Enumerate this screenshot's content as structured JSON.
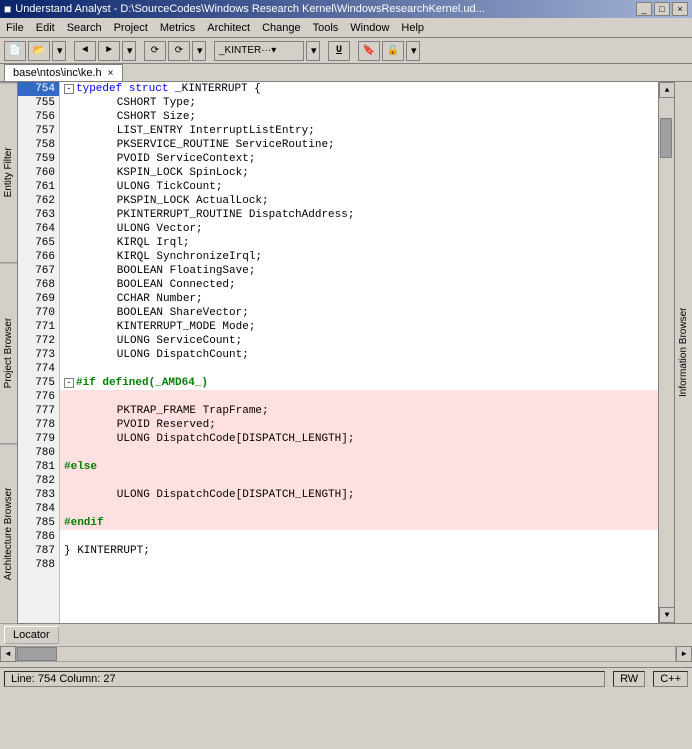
{
  "titlebar": {
    "title": "Understand Analyst - D:\\SourceCodes\\Windows Research Kernel\\WindowsResearchKernel.ud...",
    "icon": "■"
  },
  "menubar": {
    "items": [
      "File",
      "Edit",
      "Search",
      "Project",
      "Metrics",
      "Architect",
      "Change",
      "Tools",
      "Window",
      "Help"
    ]
  },
  "filetab": {
    "label": "base\\ntos\\inc\\ke.h"
  },
  "sidebar_left": {
    "labels": [
      "Entity Filter",
      "Project Browser",
      "Architecture Browser"
    ]
  },
  "sidebar_right": {
    "label": "Information Browser"
  },
  "code": {
    "lines": [
      {
        "num": 754,
        "indent": 0,
        "content": "typedef struct _KINTERRUPT {",
        "type": "typedef",
        "has_collapse": true
      },
      {
        "num": 755,
        "indent": 2,
        "content": "CSHORT Type;",
        "type": "normal"
      },
      {
        "num": 756,
        "indent": 2,
        "content": "CSHORT Size;",
        "type": "normal"
      },
      {
        "num": 757,
        "indent": 2,
        "content": "LIST_ENTRY InterruptListEntry;",
        "type": "normal"
      },
      {
        "num": 758,
        "indent": 2,
        "content": "PKSERVICE_ROUTINE ServiceRoutine;",
        "type": "normal"
      },
      {
        "num": 759,
        "indent": 2,
        "content": "PVOID ServiceContext;",
        "type": "normal"
      },
      {
        "num": 760,
        "indent": 2,
        "content": "KSPIN_LOCK SpinLock;",
        "type": "normal"
      },
      {
        "num": 761,
        "indent": 2,
        "content": "ULONG TickCount;",
        "type": "normal"
      },
      {
        "num": 762,
        "indent": 2,
        "content": "PKSPIN_LOCK ActualLock;",
        "type": "normal"
      },
      {
        "num": 763,
        "indent": 2,
        "content": "PKINTERRUPT_ROUTINE DispatchAddress;",
        "type": "normal"
      },
      {
        "num": 764,
        "indent": 2,
        "content": "ULONG Vector;",
        "type": "normal"
      },
      {
        "num": 765,
        "indent": 2,
        "content": "KIRQL Irql;",
        "type": "normal"
      },
      {
        "num": 766,
        "indent": 2,
        "content": "KIRQL SynchronizeIrql;",
        "type": "normal"
      },
      {
        "num": 767,
        "indent": 2,
        "content": "BOOLEAN FloatingSave;",
        "type": "normal"
      },
      {
        "num": 768,
        "indent": 2,
        "content": "BOOLEAN Connected;",
        "type": "normal"
      },
      {
        "num": 769,
        "indent": 2,
        "content": "CCHAR Number;",
        "type": "normal"
      },
      {
        "num": 770,
        "indent": 2,
        "content": "BOOLEAN ShareVector;",
        "type": "normal"
      },
      {
        "num": 771,
        "indent": 2,
        "content": "KINTERRUPT_MODE Mode;",
        "type": "normal"
      },
      {
        "num": 772,
        "indent": 2,
        "content": "ULONG ServiceCount;",
        "type": "normal"
      },
      {
        "num": 773,
        "indent": 2,
        "content": "ULONG DispatchCount;",
        "type": "normal"
      },
      {
        "num": 774,
        "indent": 0,
        "content": "",
        "type": "normal"
      },
      {
        "num": 775,
        "indent": 0,
        "content": "#if defined(_AMD64_)",
        "type": "if_line",
        "has_collapse": true
      },
      {
        "num": 776,
        "indent": 0,
        "content": "",
        "type": "highlighted"
      },
      {
        "num": 777,
        "indent": 2,
        "content": "PKTRAP_FRAME TrapFrame;",
        "type": "highlighted"
      },
      {
        "num": 778,
        "indent": 2,
        "content": "PVOID Reserved;",
        "type": "highlighted"
      },
      {
        "num": 779,
        "indent": 2,
        "content": "ULONG DispatchCode[DISPATCH_LENGTH];",
        "type": "highlighted"
      },
      {
        "num": 780,
        "indent": 0,
        "content": "",
        "type": "highlighted"
      },
      {
        "num": 781,
        "indent": 0,
        "content": "#else",
        "type": "else_line"
      },
      {
        "num": 782,
        "indent": 0,
        "content": "",
        "type": "highlighted"
      },
      {
        "num": 783,
        "indent": 2,
        "content": "ULONG DispatchCode[DISPATCH_LENGTH];",
        "type": "highlighted"
      },
      {
        "num": 784,
        "indent": 0,
        "content": "",
        "type": "highlighted"
      },
      {
        "num": 785,
        "indent": 0,
        "content": "#endif",
        "type": "endif_line"
      },
      {
        "num": 786,
        "indent": 0,
        "content": "",
        "type": "normal"
      },
      {
        "num": 787,
        "indent": 0,
        "content": "} KINTERRUPT;",
        "type": "end_typedef"
      },
      {
        "num": 788,
        "indent": 0,
        "content": "",
        "type": "normal"
      }
    ]
  },
  "statusbar": {
    "line_col": "Line: 754  Column: 27",
    "mode": "RW",
    "lang": "C++"
  },
  "locator": {
    "label": "Locator"
  }
}
